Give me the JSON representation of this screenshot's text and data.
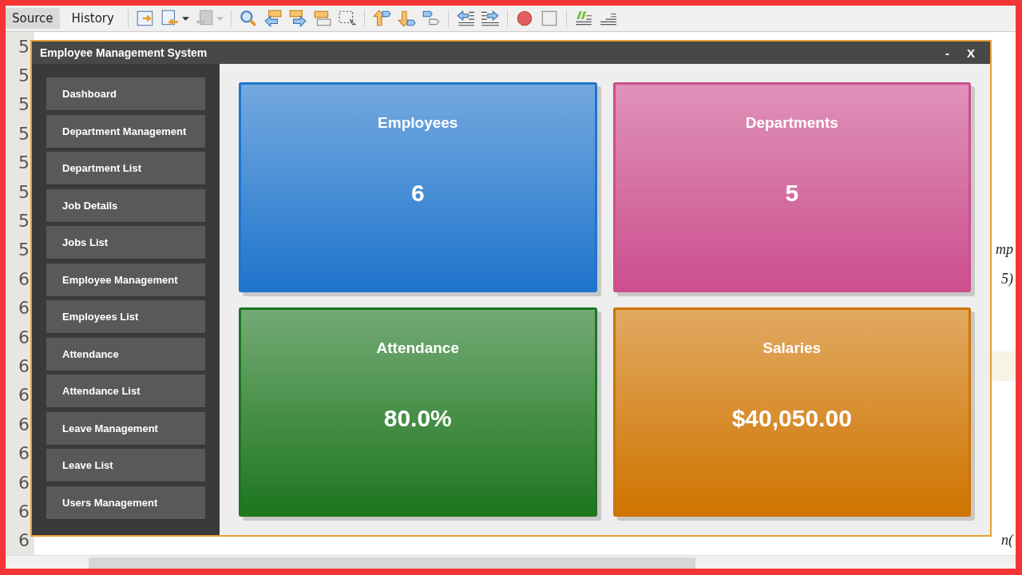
{
  "editor_tabs": [
    {
      "label": "Source",
      "selected": true
    },
    {
      "label": "History",
      "selected": false
    }
  ],
  "editor": {
    "lines": [
      {
        "number": "5"
      },
      {
        "number": "5"
      },
      {
        "number": "5"
      },
      {
        "number": "5"
      },
      {
        "number": "5"
      },
      {
        "number": "5"
      },
      {
        "number": "5"
      },
      {
        "number": "5",
        "code": "mp"
      },
      {
        "number": "6",
        "code": "5)"
      },
      {
        "number": "6"
      },
      {
        "number": "6"
      },
      {
        "number": "6"
      },
      {
        "number": "6"
      },
      {
        "number": "6"
      },
      {
        "number": "6"
      },
      {
        "number": "6"
      },
      {
        "number": "6"
      },
      {
        "number": "6",
        "code": "n("
      }
    ]
  },
  "window": {
    "title": "Employee Management System",
    "controls": [
      "-",
      "X"
    ]
  },
  "sidebar": {
    "items": [
      "Dashboard",
      "Department Management",
      "Department List",
      "Job Details",
      "Jobs List",
      "Employee Management",
      "Employees List",
      "Attendance",
      "Attendance List",
      "Leave Management",
      "Leave List",
      "Users Management"
    ]
  },
  "cards": [
    {
      "title": "Employees",
      "value": "6",
      "color": "#1f74cc"
    },
    {
      "title": "Departments",
      "value": "5",
      "color": "#cc4f8e"
    },
    {
      "title": "Attendance",
      "value": "80.0%",
      "color": "#1e761f"
    },
    {
      "title": "Salaries",
      "value": "$40,050.00",
      "color": "#cf7400"
    }
  ]
}
